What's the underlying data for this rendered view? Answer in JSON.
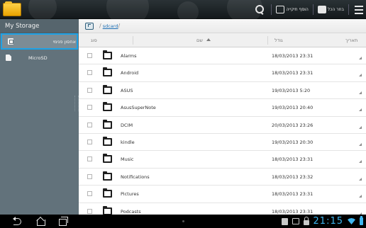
{
  "topbar": {
    "actions": {
      "select_all_label": "בחר הכל",
      "add_folder_label": "הוסף תיקייה"
    }
  },
  "sidebar": {
    "title": "My Storage",
    "items": [
      {
        "label": "אחסון פנימי",
        "icon": "internal-storage-icon",
        "active": true
      },
      {
        "label": "MicroSD",
        "icon": "sd-card-icon",
        "active": false
      }
    ]
  },
  "pathbar": {
    "separator": "/",
    "crumb": "sdcard",
    "trailing": "/"
  },
  "columns": {
    "type": "סוג",
    "name": "שם",
    "size": "גודל",
    "date": "תאריך"
  },
  "files": [
    {
      "name": "Alarms",
      "date": "18/03/2013 23:31"
    },
    {
      "name": "Android",
      "date": "18/03/2013 23:31"
    },
    {
      "name": "ASUS",
      "date": "19/03/2013 5:20"
    },
    {
      "name": "AsusSuperNote",
      "date": "19/03/2013 20:40"
    },
    {
      "name": "DCIM",
      "date": "20/03/2013 23:26"
    },
    {
      "name": "kindle",
      "date": "19/03/2013 20:30"
    },
    {
      "name": "Music",
      "date": "18/03/2013 23:31"
    },
    {
      "name": "Notifications",
      "date": "18/03/2013 23:32"
    },
    {
      "name": "Pictures",
      "date": "18/03/2013 23:31"
    },
    {
      "name": "Podcasts",
      "date": "18/03/2013 23:31"
    }
  ],
  "statusbar": {
    "clock": "21:15"
  },
  "colors": {
    "accent": "#1ea2e6",
    "sidebar_bg": "#62727b",
    "clock": "#3fb6f0"
  }
}
